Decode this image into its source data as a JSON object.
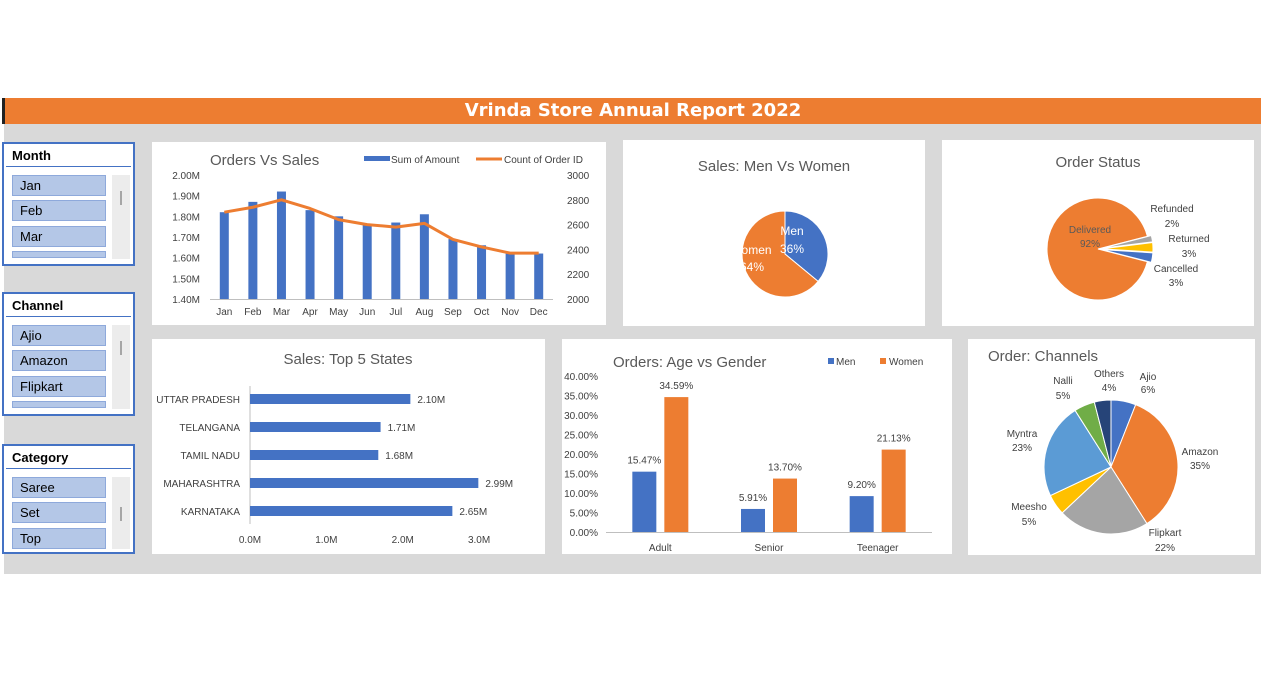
{
  "title": "Vrinda Store Annual Report 2022",
  "slicers": [
    {
      "header": "Month",
      "items": [
        "Jan",
        "Feb",
        "Mar"
      ]
    },
    {
      "header": "Channel",
      "items": [
        "Ajio",
        "Amazon",
        "Flipkart"
      ]
    },
    {
      "header": "Category",
      "items": [
        "Saree",
        "Set",
        "Top"
      ]
    }
  ],
  "colors": {
    "blue": "#4472C4",
    "orange": "#ED7D31",
    "gray": "#A5A5A5",
    "yellow": "#FFC000",
    "lightblue": "#5B9BD5",
    "green": "#70AD47",
    "navy": "#264478"
  },
  "chart_data": [
    {
      "id": "orders_vs_sales",
      "type": "bar",
      "title": "Orders Vs Sales",
      "categories": [
        "Jan",
        "Feb",
        "Mar",
        "Apr",
        "May",
        "Jun",
        "Jul",
        "Aug",
        "Sep",
        "Oct",
        "Nov",
        "Dec"
      ],
      "series": [
        {
          "name": "Sum of Amount",
          "type": "bar",
          "axis": "left",
          "values": [
            1.82,
            1.87,
            1.92,
            1.83,
            1.8,
            1.76,
            1.77,
            1.81,
            1.69,
            1.66,
            1.62,
            1.62
          ]
        },
        {
          "name": "Count of Order ID",
          "type": "line",
          "axis": "right",
          "values": [
            2700,
            2740,
            2800,
            2730,
            2640,
            2600,
            2580,
            2610,
            2480,
            2420,
            2370,
            2370
          ]
        }
      ],
      "left_axis": {
        "ticks": [
          "2.00M",
          "1.90M",
          "1.80M",
          "1.70M",
          "1.60M",
          "1.50M",
          "1.40M"
        ],
        "min": 1.4,
        "max": 2.0
      },
      "right_axis": {
        "ticks": [
          "3000",
          "2800",
          "2600",
          "2400",
          "2200",
          "2000"
        ],
        "min": 2000,
        "max": 3000
      }
    },
    {
      "id": "men_vs_women",
      "type": "pie",
      "title": "Sales: Men Vs Women",
      "slices": [
        {
          "name": "Men",
          "value": 36,
          "label": "36%"
        },
        {
          "name": "Women",
          "value": 64,
          "label": "64%"
        }
      ]
    },
    {
      "id": "order_status",
      "type": "pie",
      "title": "Order Status",
      "slices": [
        {
          "name": "Delivered",
          "value": 92,
          "label": "92%"
        },
        {
          "name": "Refunded",
          "value": 2,
          "label": "2%"
        },
        {
          "name": "Returned",
          "value": 3,
          "label": "3%"
        },
        {
          "name": "Cancelled",
          "value": 3,
          "label": "3%"
        }
      ]
    },
    {
      "id": "top_states",
      "type": "bar",
      "orientation": "horizontal",
      "title": "Sales: Top 5 States",
      "categories": [
        "UTTAR PRADESH",
        "TELANGANA",
        "TAMIL NADU",
        "MAHARASHTRA",
        "KARNATAKA"
      ],
      "values": [
        2.1,
        1.71,
        1.68,
        2.99,
        2.65
      ],
      "labels": [
        "2.10M",
        "1.71M",
        "1.68M",
        "2.99M",
        "2.65M"
      ],
      "x_ticks": [
        "0.0M",
        "1.0M",
        "2.0M",
        "3.0M"
      ],
      "xlim": [
        0,
        3.3
      ]
    },
    {
      "id": "age_vs_gender",
      "type": "bar",
      "title": "Orders: Age vs Gender",
      "categories": [
        "Adult",
        "Senior",
        "Teenager"
      ],
      "series": [
        {
          "name": "Men",
          "values": [
            15.47,
            5.91,
            9.2
          ],
          "labels": [
            "15.47%",
            "5.91%",
            "9.20%"
          ]
        },
        {
          "name": "Women",
          "values": [
            34.59,
            13.7,
            21.13
          ],
          "labels": [
            "34.59%",
            "13.70%",
            "21.13%"
          ]
        }
      ],
      "y_ticks": [
        "40.00%",
        "35.00%",
        "30.00%",
        "25.00%",
        "20.00%",
        "15.00%",
        "10.00%",
        "5.00%",
        "0.00%"
      ],
      "ylim": [
        0,
        40
      ]
    },
    {
      "id": "channels",
      "type": "pie",
      "title": "Order: Channels",
      "slices": [
        {
          "name": "Ajio",
          "value": 6,
          "label": "6%"
        },
        {
          "name": "Amazon",
          "value": 35,
          "label": "35%"
        },
        {
          "name": "Flipkart",
          "value": 22,
          "label": "22%"
        },
        {
          "name": "Meesho",
          "value": 5,
          "label": "5%"
        },
        {
          "name": "Myntra",
          "value": 23,
          "label": "23%"
        },
        {
          "name": "Nalli",
          "value": 5,
          "label": "5%"
        },
        {
          "name": "Others",
          "value": 4,
          "label": "4%"
        }
      ]
    }
  ]
}
